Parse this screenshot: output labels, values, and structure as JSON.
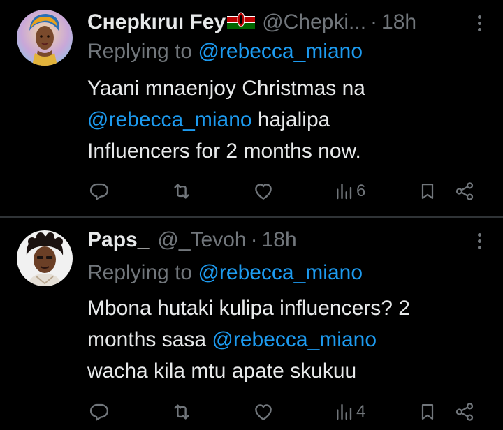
{
  "tweets": [
    {
      "author_name": "Cнepkıruı Fey",
      "flag_icon": "kenya-flag-icon",
      "handle": "@Chepki...",
      "separator": "·",
      "time": "18h",
      "replying_prefix": "Replying to",
      "replying_to": "@rebecca_miano",
      "body_line1": "Yaani mnaenjoy Christmas na",
      "body_mention": "@rebecca_miano",
      "body_line2_rest": " hajalipa",
      "body_line3": "Influencers for 2 months now.",
      "views": "6"
    },
    {
      "author_name": "Paps_",
      "handle": "@_Tevoh",
      "separator": "·",
      "time": "18h",
      "replying_prefix": "Replying to",
      "replying_to": "@rebecca_miano",
      "body_line1": "Mbona hutaki kulipa influencers? 2",
      "body_line2_pre": "months sasa ",
      "body_mention": "@rebecca_miano",
      "body_line3": "wacha kila mtu apate skukuu",
      "views": "4"
    }
  ],
  "colors": {
    "background": "#000000",
    "primary_text": "#e7e9ea",
    "secondary_text": "#71767b",
    "link": "#1d9bf0",
    "divider": "#2f3336"
  },
  "icons": [
    "reply-icon",
    "repost-icon",
    "like-icon",
    "views-icon",
    "bookmark-icon",
    "share-icon",
    "more-icon"
  ]
}
